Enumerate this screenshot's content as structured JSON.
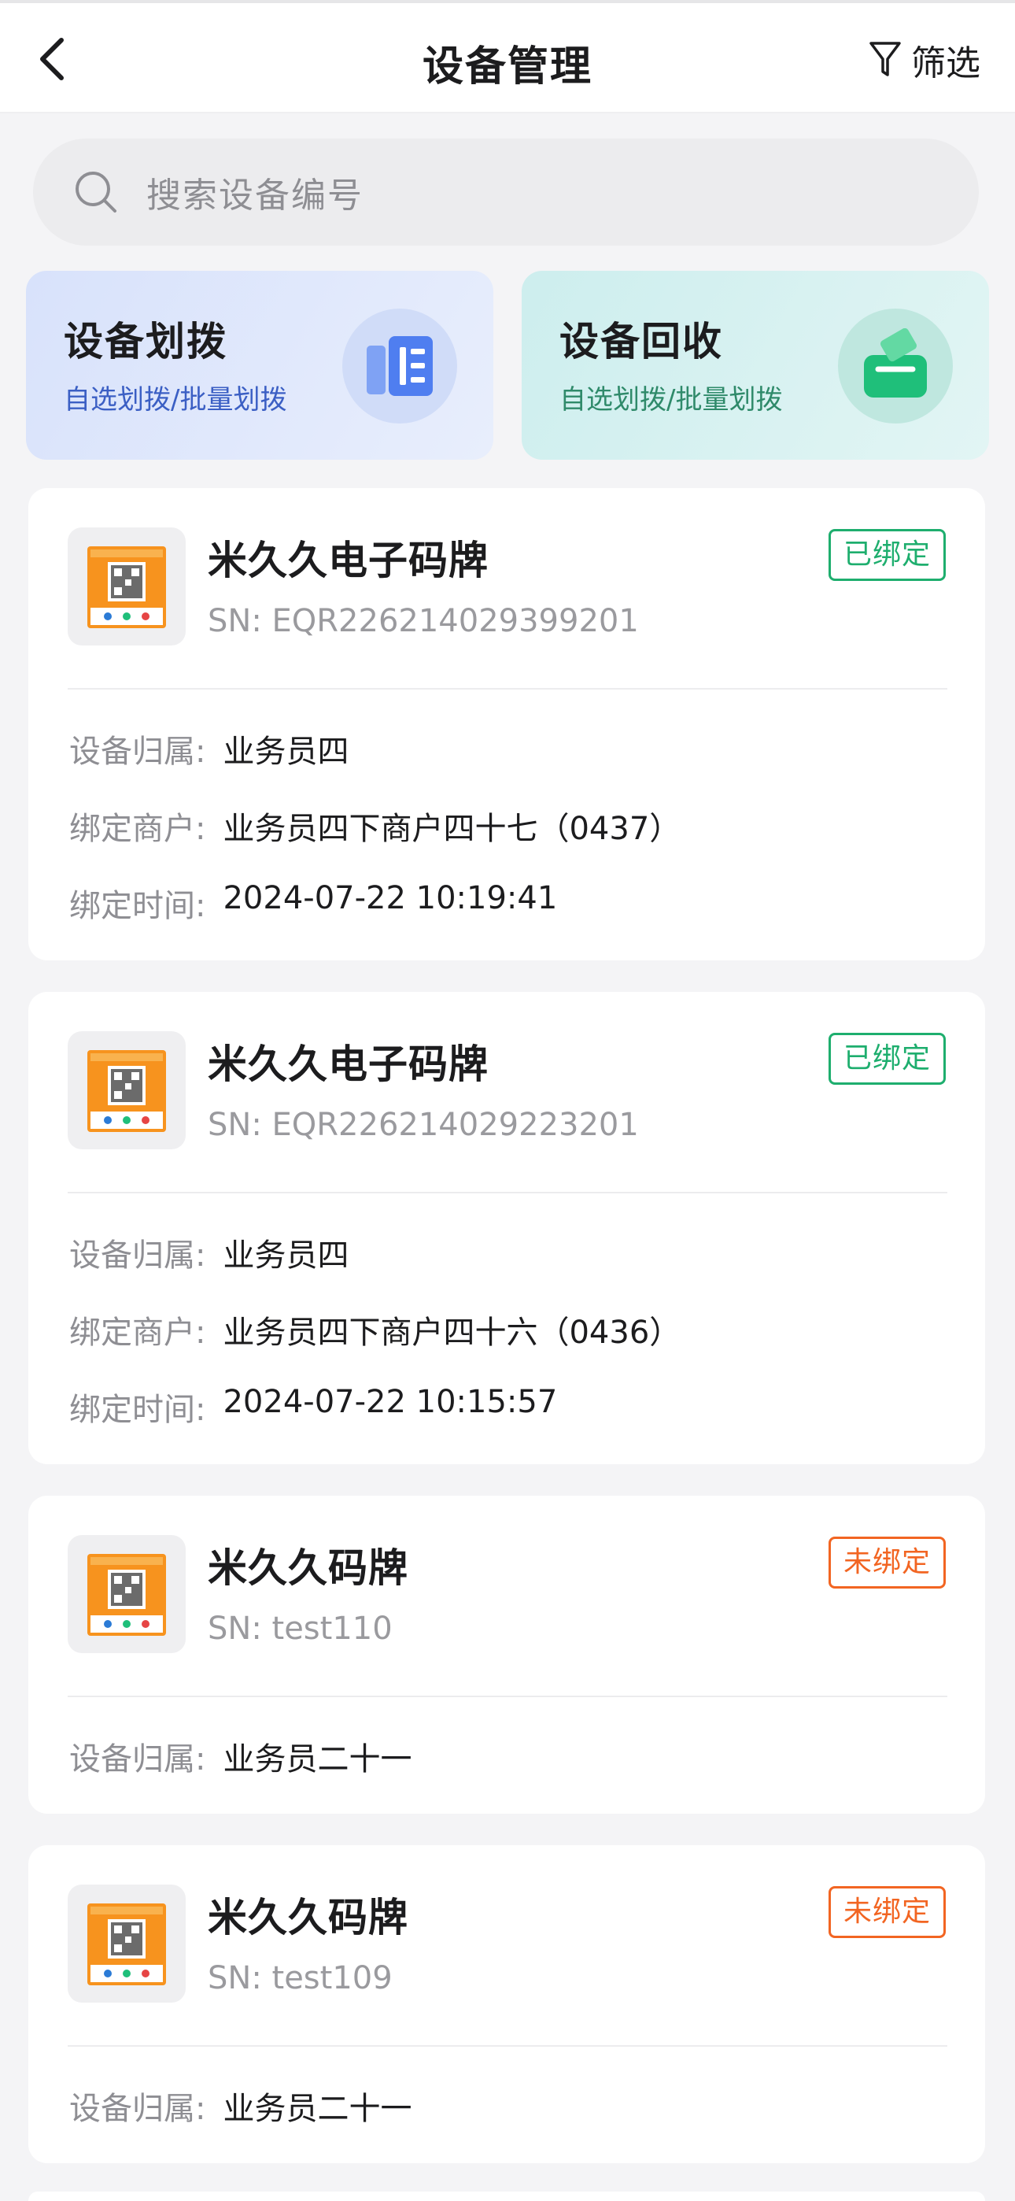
{
  "header": {
    "title": "设备管理",
    "filter_label": "筛选"
  },
  "search": {
    "placeholder": "搜索设备编号"
  },
  "quick_actions": [
    {
      "title": "设备划拨",
      "subtitle": "自选划拨/批量划拨",
      "icon": "list-icon",
      "color": "#4f7ef0"
    },
    {
      "title": "设备回收",
      "subtitle": "自选划拨/批量划拨",
      "icon": "recycle-box-icon",
      "color": "#1fbf7a"
    }
  ],
  "labels": {
    "owner": "设备归属:",
    "merchant": "绑定商户:",
    "time": "绑定时间:"
  },
  "devices": [
    {
      "name": "米久久电子码牌",
      "sn": "SN: EQR226214029399201",
      "status": "已绑定",
      "owner": "业务员四",
      "merchant": "业务员四下商户四十七（0437）",
      "time": "2024-07-22 10:19:41"
    },
    {
      "name": "米久久电子码牌",
      "sn": "SN: EQR226214029223201",
      "status": "已绑定",
      "owner": "业务员四",
      "merchant": "业务员四下商户四十六（0436）",
      "time": "2024-07-22 10:15:57"
    },
    {
      "name": "米久久码牌",
      "sn": "SN: test110",
      "status": "未绑定",
      "owner": "业务员二十一"
    },
    {
      "name": "米久久码牌",
      "sn": "SN: test109",
      "status": "未绑定",
      "owner": "业务员二十一"
    }
  ],
  "colors": {
    "bound": "#1eae6e",
    "unbound": "#f26522",
    "accent_blue": "#4f7ef0"
  }
}
